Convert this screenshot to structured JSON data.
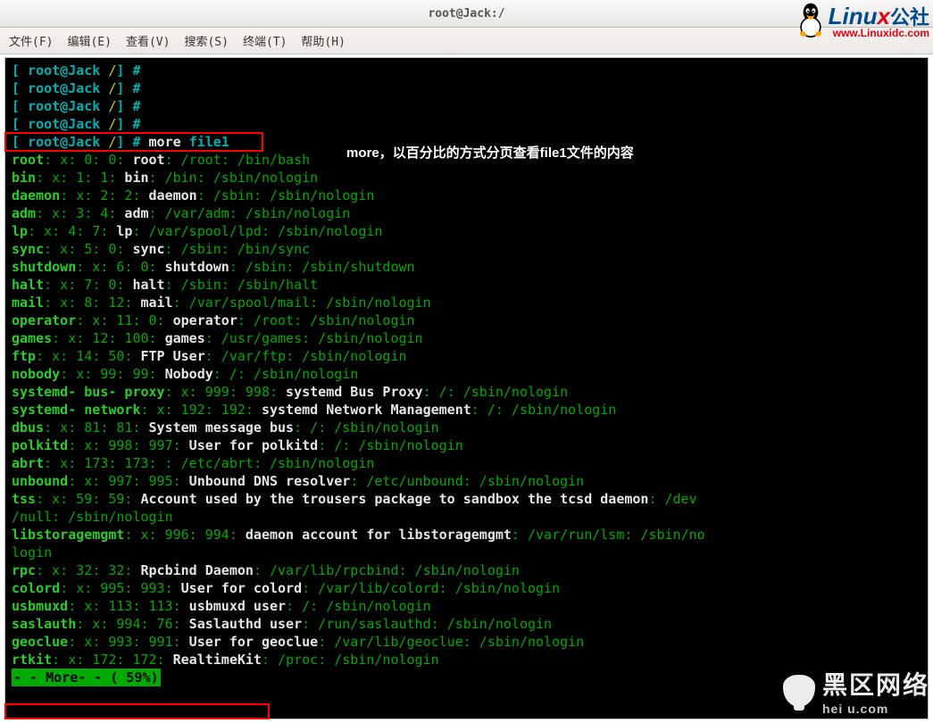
{
  "window": {
    "title": "root@Jack:/"
  },
  "menu": {
    "file": "文件(F)",
    "edit": "编辑(E)",
    "view": "查看(V)",
    "search": "搜索(S)",
    "term": "终端(T)",
    "help": "帮助(H)"
  },
  "prompt": {
    "open": "[",
    "user": "root@Jack",
    "path": "/",
    "close": "]",
    "sym": "#"
  },
  "cmd": {
    "more": "more",
    "arg": "file1"
  },
  "annotation": "more，以百分比的方式分页查看file1文件的内容",
  "more_status": "- - More- - ( 59%)",
  "lines": [
    {
      "u": "root",
      "xs": ": x: 0: 0:",
      "n": " root",
      "p1": ": /root",
      "p2": ": /bin/bash"
    },
    {
      "u": "bin",
      "xs": ": x: 1: 1:",
      "n": " bin",
      "p1": ": /bin",
      "p2": ": /sbin/nologin"
    },
    {
      "u": "daemon",
      "xs": ": x: 2: 2:",
      "n": " daemon",
      "p1": ": /sbin",
      "p2": ": /sbin/nologin"
    },
    {
      "u": "adm",
      "xs": ": x: 3: 4:",
      "n": " adm",
      "p1": ": /var/adm",
      "p2": ": /sbin/nologin"
    },
    {
      "u": "lp",
      "xs": ": x: 4: 7:",
      "n": " lp",
      "p1": ": /var/spool/lpd",
      "p2": ": /sbin/nologin"
    },
    {
      "u": "sync",
      "xs": ": x: 5: 0:",
      "n": " sync",
      "p1": ": /sbin",
      "p2": ": /bin/sync"
    },
    {
      "u": "shutdown",
      "xs": ": x: 6: 0:",
      "n": " shutdown",
      "p1": ": /sbin",
      "p2": ": /sbin/shutdown"
    },
    {
      "u": "halt",
      "xs": ": x: 7: 0:",
      "n": " halt",
      "p1": ": /sbin",
      "p2": ": /sbin/halt"
    },
    {
      "u": "mail",
      "xs": ": x: 8: 12:",
      "n": " mail",
      "p1": ": /var/spool/mail",
      "p2": ": /sbin/nologin"
    },
    {
      "u": "operator",
      "xs": ": x: 11: 0:",
      "n": " operator",
      "p1": ": /root",
      "p2": ": /sbin/nologin"
    },
    {
      "u": "games",
      "xs": ": x: 12: 100:",
      "n": " games",
      "p1": ": /usr/games",
      "p2": ": /sbin/nologin"
    },
    {
      "u": "ftp",
      "xs": ": x: 14: 50:",
      "n": " FTP User",
      "p1": ": /var/ftp",
      "p2": ": /sbin/nologin"
    },
    {
      "u": "nobody",
      "xs": ": x: 99: 99:",
      "n": " Nobody",
      "p1": ": /",
      "p2": ": /sbin/nologin"
    },
    {
      "u": "systemd- bus- proxy",
      "xs": ": x: 999: 998:",
      "n": " systemd Bus Proxy",
      "p1": ": /",
      "p2": ": /sbin/nologin"
    },
    {
      "u": "systemd- network",
      "xs": ": x: 192: 192:",
      "n": " systemd Network Management",
      "p1": ": /",
      "p2": ": /sbin/nologin"
    },
    {
      "u": "dbus",
      "xs": ": x: 81: 81:",
      "n": " System message bus",
      "p1": ": /",
      "p2": ": /sbin/nologin"
    },
    {
      "u": "polkitd",
      "xs": ": x: 998: 997:",
      "n": " User for polkitd",
      "p1": ": /",
      "p2": ": /sbin/nologin"
    },
    {
      "u": "abrt",
      "xs": ": x: 173: 173:",
      "n": " ",
      "p1": ": /etc/abrt",
      "p2": ": /sbin/nologin"
    },
    {
      "u": "unbound",
      "xs": ": x: 997: 995:",
      "n": " Unbound DNS resolver",
      "p1": ": /etc/unbound",
      "p2": ": /sbin/nologin"
    }
  ],
  "tss": {
    "u": "tss",
    "xs": ": x: 59: 59:",
    "n": " Account used by the trousers package to sandbox the tcsd daemon",
    "p1": ": /dev",
    "cont": "/null",
    "p2": ": /sbin/nologin"
  },
  "lsm": {
    "u": "libstoragemgmt",
    "xs": ": x: 996: 994:",
    "n": " daemon account for libstoragemgmt",
    "p1": ": /var/run/lsm",
    "p2head": ": /sbin/no",
    "p2tail": "login"
  },
  "lines2": [
    {
      "u": "rpc",
      "xs": ": x: 32: 32:",
      "n": " Rpcbind Daemon",
      "p1": ": /var/lib/rpcbind",
      "p2": ": /sbin/nologin"
    },
    {
      "u": "colord",
      "xs": ": x: 995: 993:",
      "n": " User for colord",
      "p1": ": /var/lib/colord",
      "p2": ": /sbin/nologin"
    },
    {
      "u": "usbmuxd",
      "xs": ": x: 113: 113:",
      "n": " usbmuxd user",
      "p1": ": /",
      "p2": ": /sbin/nologin"
    },
    {
      "u": "saslauth",
      "xs": ": x: 994: 76:",
      "n": " Saslauthd user",
      "p1": ": /run/saslauthd",
      "p2": ": /sbin/nologin"
    },
    {
      "u": "geoclue",
      "xs": ": x: 993: 991:",
      "n": " User for geoclue",
      "p1": ": /var/lib/geoclue",
      "p2": ": /sbin/nologin"
    },
    {
      "u": "rtkit",
      "xs": ": x: 172: 172:",
      "n": " RealtimeKit",
      "p1": ": /proc",
      "p2": ": /sbin/nologin"
    }
  ],
  "watermark1": {
    "brand": "Linu",
    "brandx": "x",
    "cn": "公社",
    "sub": "www.Linuxidc.com"
  },
  "watermark2": {
    "cn": "黑区网络",
    "sub": "hei  u.com"
  }
}
